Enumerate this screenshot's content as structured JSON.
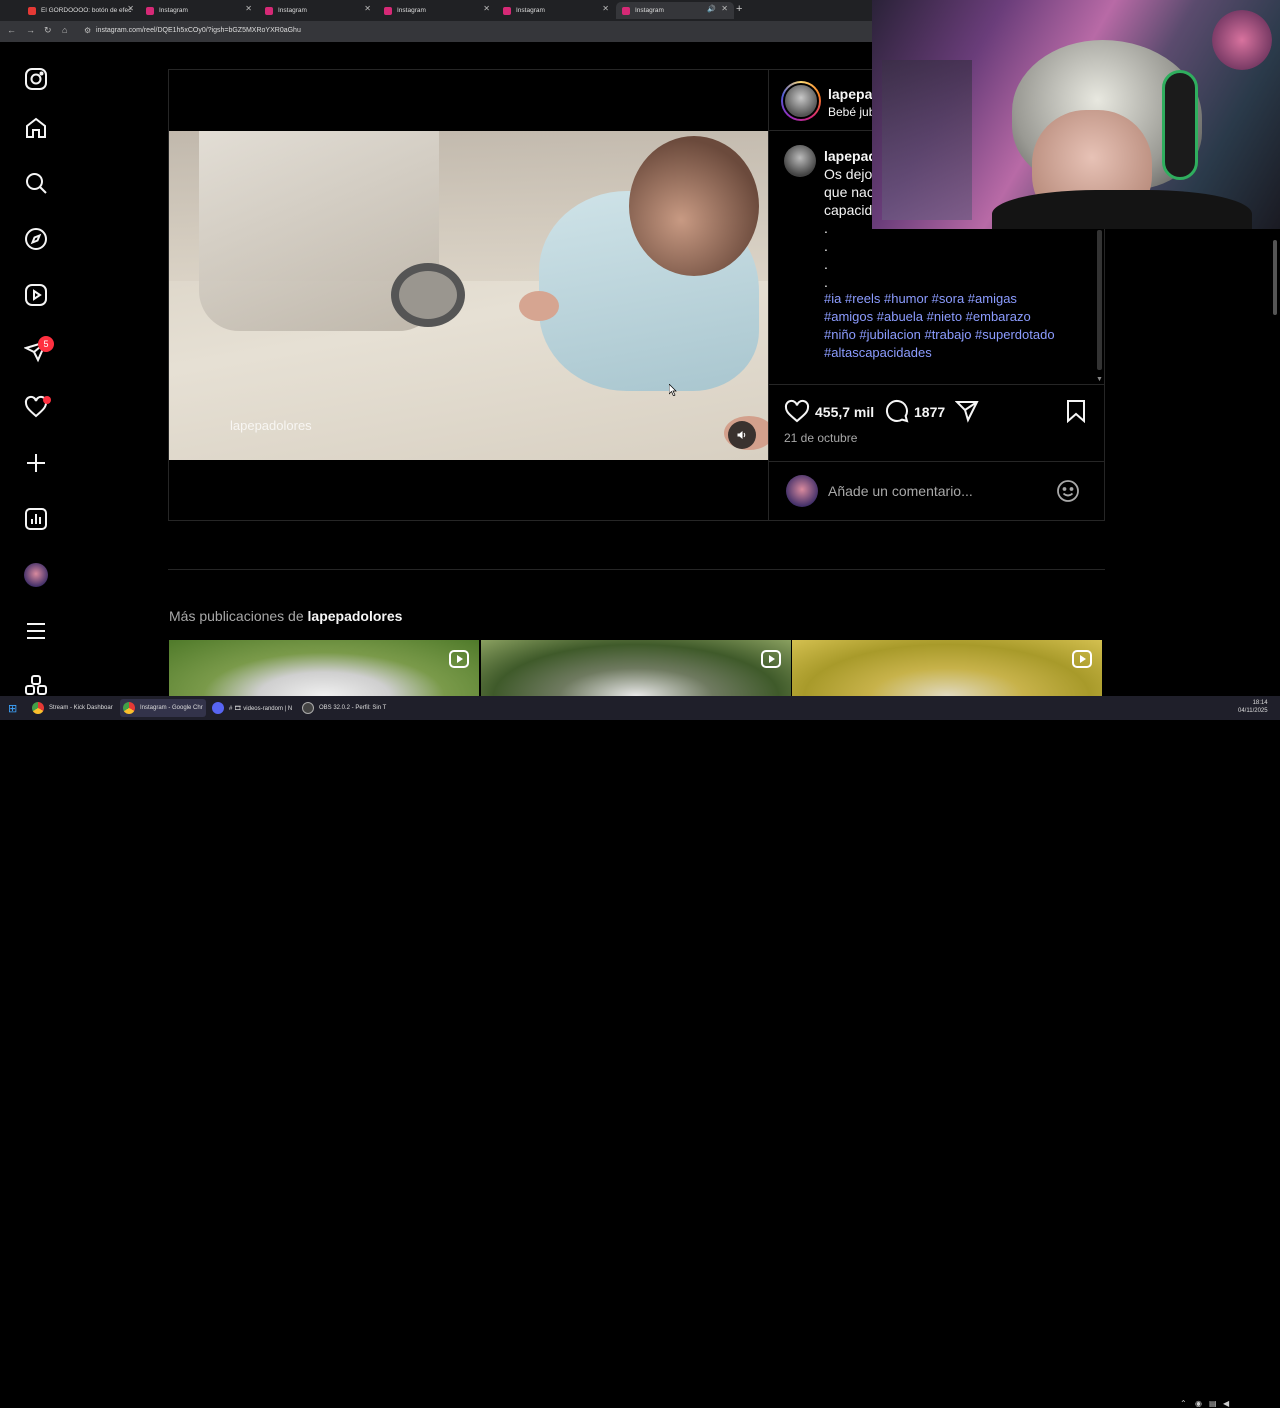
{
  "browser": {
    "tabs": [
      {
        "title": "El GORDOOOO: botón de efec",
        "favicon_color": "#e53935"
      },
      {
        "title": "Instagram",
        "favicon_color": "#d62976"
      },
      {
        "title": "Instagram",
        "favicon_color": "#d62976"
      },
      {
        "title": "Instagram",
        "favicon_color": "#d62976"
      },
      {
        "title": "Instagram",
        "favicon_color": "#d62976"
      },
      {
        "title": "Instagram",
        "favicon_color": "#d62976"
      }
    ],
    "active_tab": 5,
    "url": "instagram.com/reel/DQE1h5xCOy0/?igsh=bGZ5MXRoYXR0aGhu"
  },
  "nav": {
    "items": [
      "instagram-logo-icon",
      "home-icon",
      "search-icon",
      "explore-icon",
      "reels-icon",
      "messages-icon",
      "notifications-icon",
      "create-icon",
      "dashboard-icon",
      "profile-avatar",
      "menu-icon",
      "apps-icon"
    ],
    "messages_badge": "5"
  },
  "post": {
    "watermark": "lapepadolores",
    "header_user": "lapepa",
    "header_subtitle": "Bebé jub",
    "caption_user": "lapepad",
    "caption_lines": [
      "Os dejo",
      "que nac",
      "capacid",
      ".",
      ".",
      ".",
      "."
    ],
    "hashtags": [
      "#ia #reels #humor #sora #amigas",
      "#amigos #abuela #nieto #embarazo",
      "#niño #jubilacion #trabajo #superdotado",
      "#altascapacidades"
    ],
    "likes": "455,7 mil",
    "comments": "1877",
    "date": "21 de octubre",
    "comment_placeholder": "Añade un comentario..."
  },
  "more": {
    "prefix": "Más publicaciones de ",
    "user": "lapepadolores"
  },
  "taskbar": {
    "items": [
      "Stream - Kick Dashboar",
      "Instagram - Google Chr",
      "# 🎞 videos-random | N",
      "OBS 32.0.2 - Perfil: Sin T"
    ],
    "time": "18:14",
    "date": "04/11/2025"
  },
  "colors": {
    "accent_link": "#8c9cff",
    "badge": "#ff3040"
  }
}
